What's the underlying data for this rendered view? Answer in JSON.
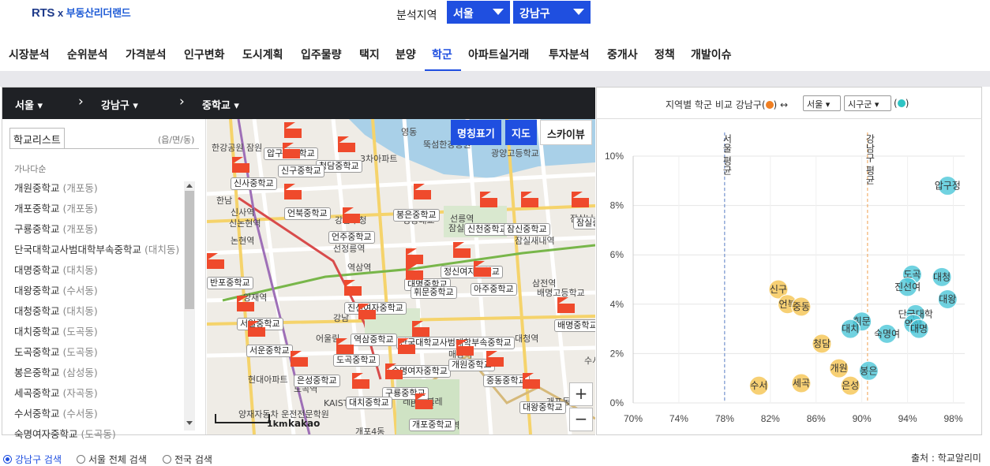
{
  "brand": {
    "name": "RTS",
    "x": "x",
    "partner": "부동산리더랜드"
  },
  "region": {
    "label": "분석지역",
    "city": "서울",
    "district": "강남구"
  },
  "nav": [
    "시장분석",
    "순위분석",
    "가격분석",
    "인구변화",
    "도시계획",
    "입주물량",
    "택지",
    "분양",
    "학군",
    "아파트실거래",
    "투자분석",
    "중개사",
    "정책",
    "개발이슈"
  ],
  "nav_active": "학군",
  "breadcrumb": {
    "city": "서울",
    "district": "강남구",
    "level": "중학교"
  },
  "school_list": {
    "tab": "학교리스트",
    "unit": "(읍/면/동)",
    "sort": "가나다순",
    "items": [
      {
        "name": "개원중학교",
        "dong": "(개포동)"
      },
      {
        "name": "개포중학교",
        "dong": "(개포동)"
      },
      {
        "name": "구룡중학교",
        "dong": "(개포동)"
      },
      {
        "name": "단국대학교사범대학부속중학교",
        "dong": "(대치동)"
      },
      {
        "name": "대명중학교",
        "dong": "(대치동)"
      },
      {
        "name": "대왕중학교",
        "dong": "(수서동)"
      },
      {
        "name": "대청중학교",
        "dong": "(대치동)"
      },
      {
        "name": "대치중학교",
        "dong": "(도곡동)"
      },
      {
        "name": "도곡중학교",
        "dong": "(도곡동)"
      },
      {
        "name": "봉은중학교",
        "dong": "(삼성동)"
      },
      {
        "name": "세곡중학교",
        "dong": "(자곡동)"
      },
      {
        "name": "수서중학교",
        "dong": "(수서동)"
      },
      {
        "name": "숙명여자중학교",
        "dong": "(도곡동)"
      }
    ]
  },
  "map": {
    "buttons": {
      "names": "명칭표기",
      "map": "지도",
      "skyview": "스카이뷰"
    },
    "zoom_in": "+",
    "zoom_out": "−",
    "scale": "1km",
    "provider": "kakao",
    "place_labels": [
      "한강공원 잠원",
      "영동",
      "신사역",
      "3차아파트",
      "뚝섬한강공원",
      "광양고등학교",
      "한남",
      "영동대교",
      "신논현역",
      "논현역",
      "강남구청",
      "선정릉역",
      "선릉역",
      "잠실종합운동장",
      "잠실나루",
      "잠실새내역",
      "역삼역",
      "강남",
      "양재역",
      "어울림",
      "현대아파트",
      "도곡역",
      "개포4동",
      "대모산",
      "매봉역",
      "KAIST 도곡캠퍼스",
      "레미안블레",
      "양재자동차 운전전문학원",
      "삼전역",
      "배명고등학교",
      "수서",
      "개포동",
      "대청역",
      "일원역"
    ],
    "school_pins": [
      "압구정중학교",
      "청담중학교",
      "신구중학교",
      "신사중학교",
      "언북중학교",
      "언주중학교",
      "봉은중학교",
      "신천중학교",
      "잠신중학교",
      "잠실중",
      "정신여자중학교",
      "대명중학교",
      "휘문중학교",
      "아주중학교",
      "진선여자중학교",
      "서일중학교",
      "역삼중학교",
      "단국대학교사범대학부속중학교",
      "배명중학교",
      "서운중학교",
      "도곡중학교",
      "숙명여자중학교",
      "개원중학교",
      "은성중학교",
      "구룡중학교",
      "중동중학교",
      "대치중학교",
      "대왕중학교",
      "개포중학교",
      "반포중학교"
    ]
  },
  "chart_panel": {
    "title": "지역별 학군 비교 강남구(",
    "title_mid": ") ↔",
    "title_end": ")",
    "select_city": "서울",
    "select_level": "시구군"
  },
  "chart_data": {
    "type": "scatter",
    "xlabel": "",
    "ylabel": "",
    "xlim": [
      70,
      99
    ],
    "ylim": [
      0,
      10
    ],
    "x_ticks": [
      "70%",
      "74%",
      "78%",
      "82%",
      "86%",
      "90%",
      "94%",
      "98%"
    ],
    "y_ticks": [
      "0%",
      "2%",
      "4%",
      "6%",
      "8%",
      "10%"
    ],
    "reference_lines": [
      {
        "label": "서울 평균",
        "x": 78.0,
        "color": "#5b7fc7"
      },
      {
        "label": "강남구 평균",
        "x": 90.5,
        "color": "#f0a050"
      }
    ],
    "series": [
      {
        "name": "서울",
        "color": "#f5c451",
        "points": [
          {
            "label": "신구",
            "x": 82.7,
            "y": 4.6
          },
          {
            "label": "언북",
            "x": 83.5,
            "y": 4.0
          },
          {
            "label": "중동",
            "x": 84.7,
            "y": 3.9
          },
          {
            "label": "청담",
            "x": 86.5,
            "y": 2.4
          },
          {
            "label": "개원",
            "x": 88.0,
            "y": 1.4
          },
          {
            "label": "세곡",
            "x": 84.7,
            "y": 0.8
          },
          {
            "label": "은성",
            "x": 89.0,
            "y": 0.7
          },
          {
            "label": "수서",
            "x": 81.0,
            "y": 0.7
          }
        ]
      },
      {
        "name": "강남구",
        "color": "#4cc7d8",
        "points": [
          {
            "label": "압구정",
            "x": 97.5,
            "y": 8.8
          },
          {
            "label": "도곡",
            "x": 94.4,
            "y": 5.2
          },
          {
            "label": "대청",
            "x": 97.0,
            "y": 5.1
          },
          {
            "label": "진선여",
            "x": 94.0,
            "y": 4.7
          },
          {
            "label": "대왕",
            "x": 97.5,
            "y": 4.2
          },
          {
            "label": "단국대학",
            "x": 94.7,
            "y": 3.6
          },
          {
            "label": "휘문",
            "x": 90.0,
            "y": 3.3
          },
          {
            "label": "대치",
            "x": 89.0,
            "y": 3.0
          },
          {
            "label": "역삼",
            "x": 94.5,
            "y": 3.2
          },
          {
            "label": "숙명여",
            "x": 92.2,
            "y": 2.8
          },
          {
            "label": "대명",
            "x": 95.0,
            "y": 3.0
          },
          {
            "label": "봉은",
            "x": 90.6,
            "y": 1.3
          }
        ]
      }
    ]
  },
  "bottom": {
    "radio_gangnam": "강남구 검색",
    "radio_seoul": "서울 전체 검색",
    "radio_nation": "전국 검색",
    "source": "출처 : 학교알리미"
  },
  "colors": {
    "accent": "#1f4fe0",
    "crumb_bg": "#1f2125",
    "pin": "#ef4a2c",
    "seoul": "#f5c451",
    "gangnam": "#4cc7d8"
  }
}
